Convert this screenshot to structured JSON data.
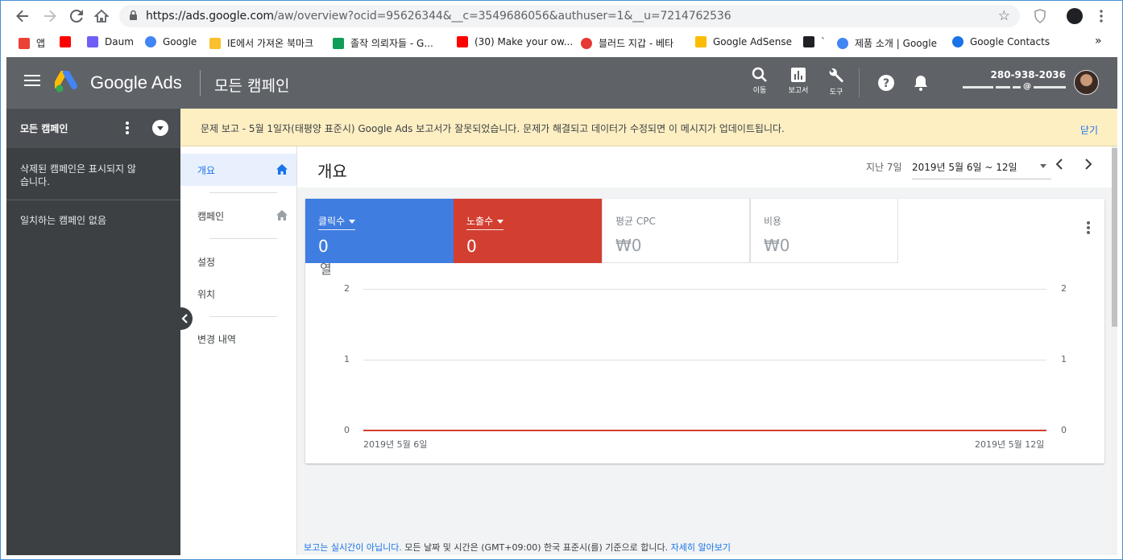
{
  "browser": {
    "url_host": "https://ads.google.com",
    "url_path": "/aw/overview?ocid=95626344&__c=3549686056&authuser=1&__u=7214762536",
    "bookmarks": [
      {
        "label": "앱",
        "icon": "apps-grid-icon",
        "color": "#ea4335"
      },
      {
        "label": "",
        "icon": "youtube-icon",
        "color": "#ff0000"
      },
      {
        "label": "Daum",
        "icon": "daum-icon",
        "color": "#6f5ff6"
      },
      {
        "label": "Google",
        "icon": "google-icon",
        "color": "#4285f4"
      },
      {
        "label": "IE에서 가져온 북마크",
        "icon": "folder-icon",
        "color": "#fbc02d"
      },
      {
        "label": "졸작 의뢰자들 - G...",
        "icon": "sheets-icon",
        "color": "#0f9d58"
      },
      {
        "label": "(30) Make your ow...",
        "icon": "youtube-icon",
        "color": "#ff0000"
      },
      {
        "label": "블러드 지갑 - 베타",
        "icon": "blood-wallet-icon",
        "color": "#e53935"
      },
      {
        "label": "Google AdSense",
        "icon": "adsense-icon",
        "color": "#fbbc04"
      },
      {
        "label": "`",
        "icon": "dots-icon",
        "color": "#202124"
      },
      {
        "label": "제품 소개 | Google",
        "icon": "google-icon",
        "color": "#4285f4"
      },
      {
        "label": "Google Contacts",
        "icon": "contacts-icon",
        "color": "#1a73e8"
      }
    ],
    "more": "»"
  },
  "header": {
    "brand": "Google Ads",
    "page_title": "모든 캠페인",
    "tools": [
      {
        "label": "이동",
        "icon": "search-icon"
      },
      {
        "label": "보고서",
        "icon": "reports-icon"
      },
      {
        "label": "도구",
        "icon": "wrench-icon"
      }
    ],
    "account_id": "280-938-2036",
    "account_email_prefix": "@"
  },
  "left_panel": {
    "title": "모든 캠페인",
    "message_1": "삭제된 캠페인은 표시되지 않습니다.",
    "message_2": "일치하는 캠페인 없음"
  },
  "banner": {
    "text": "문제 보고 - 5월 1일자(태평양 표준시) Google Ads 보고서가 잘못되었습니다. 문제가 해결되고 데이터가 수정되면 이 메시지가 업데이트됩니다.",
    "close": "닫기"
  },
  "nav": {
    "items": [
      "개요",
      "캠페인",
      "설정",
      "위치",
      "변경 내역"
    ]
  },
  "overview": {
    "title": "개요",
    "period_label": "지난 7일",
    "date_range": "2019년 5월 6일 ~ 12일",
    "metrics": [
      {
        "label": "클릭수",
        "value": "0",
        "color": "#3f7de0"
      },
      {
        "label": "노출수",
        "value": "0",
        "color": "#d23f31"
      },
      {
        "label": "평균 CPC",
        "value": "₩0"
      },
      {
        "label": "비용",
        "value": "₩0"
      }
    ],
    "chart_fragment": "열"
  },
  "chart_data": {
    "type": "line",
    "x": [
      "2019년 5월 6일",
      "2019년 5월 12일"
    ],
    "series": [
      {
        "name": "클릭수",
        "values": [
          0,
          0
        ],
        "color": "#3f7de0"
      },
      {
        "name": "노출수",
        "values": [
          0,
          0
        ],
        "color": "#d23f31"
      }
    ],
    "y_ticks_left": [
      0,
      1,
      2
    ],
    "y_ticks_right": [
      0,
      1,
      2
    ],
    "ylim": [
      0,
      2
    ],
    "grid": true
  },
  "footer": {
    "note_link": "보고는 실시간이 아닙니다.",
    "note_text": " 모든 날짜 및 시간은 (GMT+09:00) 한국 표준시(를) 기준으로 합니다. ",
    "learn_more": "자세히 알아보기"
  }
}
